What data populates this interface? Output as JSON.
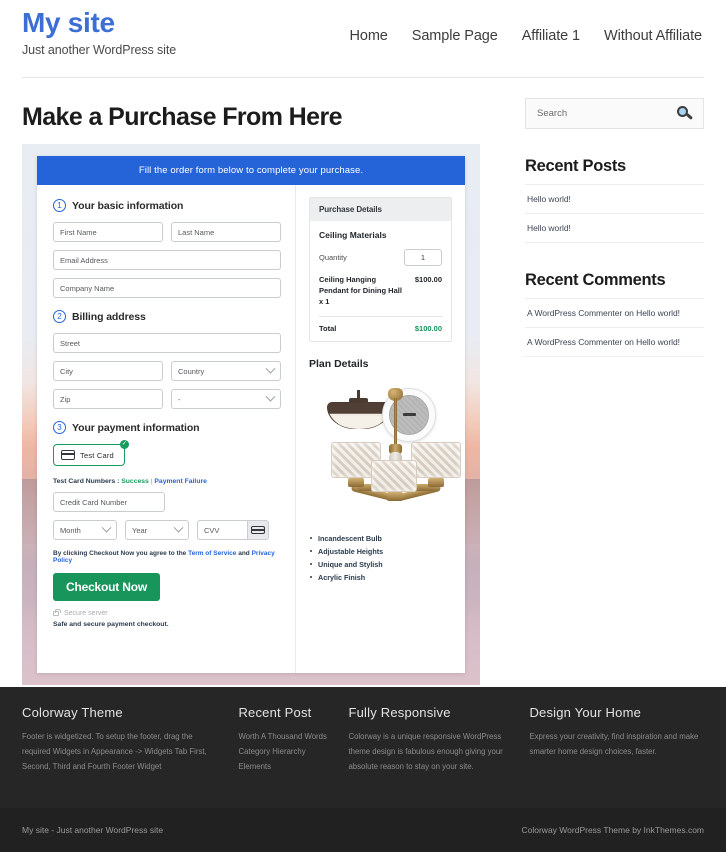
{
  "header": {
    "site_title": "My site",
    "tagline": "Just another WordPress site",
    "nav": [
      {
        "label": "Home"
      },
      {
        "label": "Sample Page"
      },
      {
        "label": "Affiliate 1"
      },
      {
        "label": "Without Affiliate"
      }
    ]
  },
  "main": {
    "page_title": "Make a Purchase From Here",
    "form": {
      "banner": "Fill the order form below to complete your purchase.",
      "steps": [
        {
          "number": "1",
          "title": "Your basic information"
        },
        {
          "number": "2",
          "title": "Billing address"
        },
        {
          "number": "3",
          "title": "Your payment information"
        }
      ],
      "fields": {
        "first_name": "First Name",
        "last_name": "Last Name",
        "email": "Email Address",
        "company": "Company Name",
        "street": "Street",
        "city": "City",
        "country": "Country",
        "zip": "Zip",
        "state": "-",
        "credit_card": "Credit Card Number",
        "month": "Month",
        "year": "Year",
        "cvv": "CVV"
      },
      "payment_method": {
        "label": "Test Card",
        "selected_mark": "✓"
      },
      "test_card_numbers": {
        "prefix": "Test Card Numbers :",
        "success": "Success",
        "separator": "|",
        "failure": "Payment Failure"
      },
      "agreement": {
        "lead": "By clicking Checkout Now you agree to the",
        "terms": "Term of Service",
        "and": "and",
        "privacy": "Privacy Policy"
      },
      "checkout_button": "Checkout Now",
      "secure_server": "Secure server",
      "safe_note": "Safe and secure payment checkout."
    },
    "purchase_details": {
      "heading": "Purchase Details",
      "product_group": "Ceiling Materials",
      "quantity_label": "Quantity",
      "quantity_value": "1",
      "line_item_name": "Ceiling Hanging Pendant for Dining Hall x 1",
      "line_item_price": "$100.00",
      "total_label": "Total",
      "total_value": "$100.00",
      "total_color": "#17955b"
    },
    "plan_details": {
      "heading": "Plan Details",
      "features": [
        "Incandescent Bulb",
        "Adjustable Heights",
        "Unique and Stylish",
        "Acrylic Finish"
      ]
    }
  },
  "sidebar": {
    "search": {
      "placeholder": "Search",
      "icon": "search-icon"
    },
    "recent_posts": {
      "title": "Recent Posts",
      "items": [
        "Hello world!",
        "Hello world!"
      ]
    },
    "recent_comments": {
      "title": "Recent Comments",
      "items": [
        "A WordPress Commenter on Hello world!",
        "A WordPress Commenter on Hello world!"
      ]
    }
  },
  "footer": {
    "columns": [
      {
        "title": "Colorway Theme",
        "text": "Footer is widgetized. To setup the footer, drag the required Widgets in Appearance -> Widgets Tab First, Second, Third and Fourth Footer Widget"
      },
      {
        "title": "Recent Post",
        "items": [
          "Worth A Thousand Words",
          "Category Hierarchy",
          "Elements"
        ]
      },
      {
        "title": "Fully Responsive",
        "text": "Colorway is a unique responsive WordPress theme design is fabulous enough giving your absolute reason to stay on your site."
      },
      {
        "title": "Design Your Home",
        "text": "Express your creativity, find inspiration and make smarter home design choices, faster."
      }
    ],
    "bottom_left": "My site - Just another WordPress site",
    "bottom_right": "Colorway WordPress Theme by InkThemes.com"
  },
  "colors": {
    "brand_blue": "#3b6fd4",
    "banner_blue": "#2563d9",
    "accent_green": "#17955b",
    "footer_bg": "#262626"
  }
}
